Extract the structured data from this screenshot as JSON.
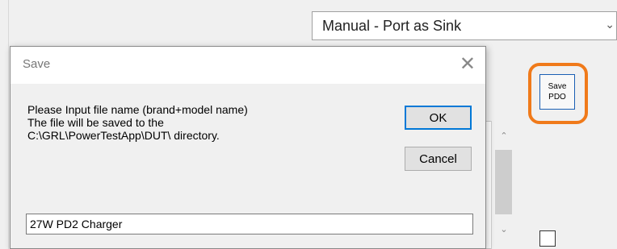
{
  "app": {
    "mode_select": {
      "value": "Manual - Port as Sink"
    },
    "save_pdo_button": {
      "line1": "Save",
      "line2": "PDO"
    },
    "highlight_color": "#f07a1a"
  },
  "dialog": {
    "title": "Save",
    "message_line1": "Please Input file name (brand+model name)",
    "message_line2": "The file will be saved to the",
    "message_line3": "C:\\GRL\\PowerTestApp\\DUT\\ directory.",
    "ok_label": "OK",
    "cancel_label": "Cancel",
    "filename_value": "27W PD2 Charger"
  },
  "icons": {
    "close": "close-icon",
    "dropdown": "chevron-down-icon",
    "scroll_up": "chevron-up-icon",
    "scroll_down": "chevron-down-icon"
  }
}
